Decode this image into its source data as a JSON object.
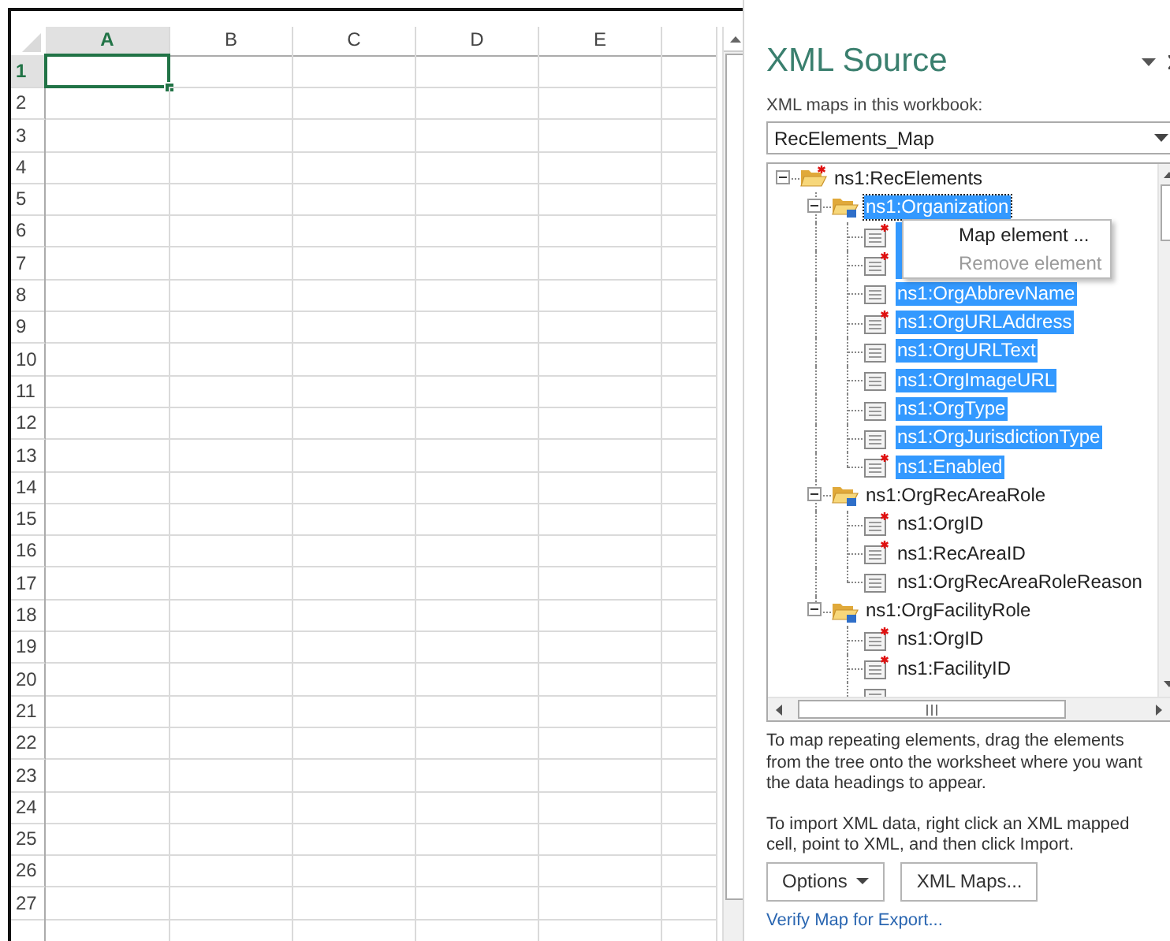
{
  "sheet": {
    "columns": [
      {
        "label": "A",
        "selected": true
      },
      {
        "label": "B",
        "selected": false
      },
      {
        "label": "C",
        "selected": false
      },
      {
        "label": "D",
        "selected": false
      },
      {
        "label": "E",
        "selected": false
      }
    ],
    "rows": [
      {
        "label": "1",
        "selected": true
      },
      {
        "label": "2",
        "selected": false
      },
      {
        "label": "3",
        "selected": false
      },
      {
        "label": "4",
        "selected": false
      },
      {
        "label": "5",
        "selected": false
      },
      {
        "label": "6",
        "selected": false
      },
      {
        "label": "7",
        "selected": false
      },
      {
        "label": "8",
        "selected": false
      },
      {
        "label": "9",
        "selected": false
      },
      {
        "label": "10",
        "selected": false
      },
      {
        "label": "11",
        "selected": false
      },
      {
        "label": "12",
        "selected": false
      },
      {
        "label": "13",
        "selected": false
      },
      {
        "label": "14",
        "selected": false
      },
      {
        "label": "15",
        "selected": false
      },
      {
        "label": "16",
        "selected": false
      },
      {
        "label": "17",
        "selected": false
      },
      {
        "label": "18",
        "selected": false
      },
      {
        "label": "19",
        "selected": false
      },
      {
        "label": "20",
        "selected": false
      },
      {
        "label": "21",
        "selected": false
      },
      {
        "label": "22",
        "selected": false
      },
      {
        "label": "23",
        "selected": false
      },
      {
        "label": "24",
        "selected": false
      },
      {
        "label": "25",
        "selected": false
      },
      {
        "label": "26",
        "selected": false
      },
      {
        "label": "27",
        "selected": false
      }
    ]
  },
  "panel": {
    "title": "XML Source",
    "maps_label": "XML maps in this workbook:",
    "map_select": {
      "value": "RecElements_Map"
    },
    "tree": [
      {
        "label": "ns1:RecElements",
        "kind": "folder",
        "required": true,
        "repeating": false,
        "expanded": true,
        "selected": false,
        "children": [
          {
            "label": "ns1:Organization",
            "kind": "folder",
            "required": false,
            "repeating": true,
            "expanded": true,
            "selected": true,
            "children": [
              {
                "kind": "element",
                "required": true,
                "repeating": false,
                "selected": true
              },
              {
                "kind": "element",
                "required": true,
                "repeating": false,
                "selected": true
              },
              {
                "label": "ns1:OrgAbbrevName",
                "kind": "element",
                "required": false,
                "repeating": false,
                "selected": true
              },
              {
                "label": "ns1:OrgURLAddress",
                "kind": "element",
                "required": true,
                "repeating": false,
                "selected": true
              },
              {
                "label": "ns1:OrgURLText",
                "kind": "element",
                "required": false,
                "repeating": false,
                "selected": true
              },
              {
                "label": "ns1:OrgImageURL",
                "kind": "element",
                "required": false,
                "repeating": false,
                "selected": true
              },
              {
                "label": "ns1:OrgType",
                "kind": "element",
                "required": false,
                "repeating": false,
                "selected": true
              },
              {
                "label": "ns1:OrgJurisdictionType",
                "kind": "element",
                "required": false,
                "repeating": false,
                "selected": true
              },
              {
                "label": "ns1:Enabled",
                "kind": "element",
                "required": true,
                "repeating": false,
                "selected": true
              }
            ]
          },
          {
            "label": "ns1:OrgRecAreaRole",
            "kind": "folder",
            "required": false,
            "repeating": true,
            "expanded": true,
            "selected": false,
            "children": [
              {
                "label": "ns1:OrgID",
                "kind": "element",
                "required": true,
                "repeating": false,
                "selected": false
              },
              {
                "label": "ns1:RecAreaID",
                "kind": "element",
                "required": true,
                "repeating": false,
                "selected": false
              },
              {
                "label": "ns1:OrgRecAreaRoleReason",
                "kind": "element",
                "required": false,
                "repeating": false,
                "selected": false
              }
            ]
          },
          {
            "label": "ns1:OrgFacilityRole",
            "kind": "folder",
            "required": false,
            "repeating": true,
            "expanded": true,
            "selected": false,
            "children": [
              {
                "label": "ns1:OrgID",
                "kind": "element",
                "required": true,
                "repeating": false,
                "selected": false
              },
              {
                "label": "ns1:FacilityID",
                "kind": "element",
                "required": true,
                "repeating": false,
                "selected": false
              },
              {
                "kind": "element"
              }
            ]
          }
        ]
      }
    ],
    "context_menu": [
      {
        "label": "Map element ...",
        "disabled": false
      },
      {
        "label": "Remove element",
        "disabled": true
      }
    ],
    "help": [
      "To map repeating elements, drag the elements from the tree onto the worksheet where you want the data headings to appear.",
      "To import XML data, right click an XML mapped cell, point to XML, and then click Import."
    ],
    "buttons": [
      {
        "label": "Options",
        "kind": "menu"
      },
      {
        "label": "XML Maps...",
        "kind": "plain"
      }
    ],
    "link": "Verify Map for Export..."
  }
}
